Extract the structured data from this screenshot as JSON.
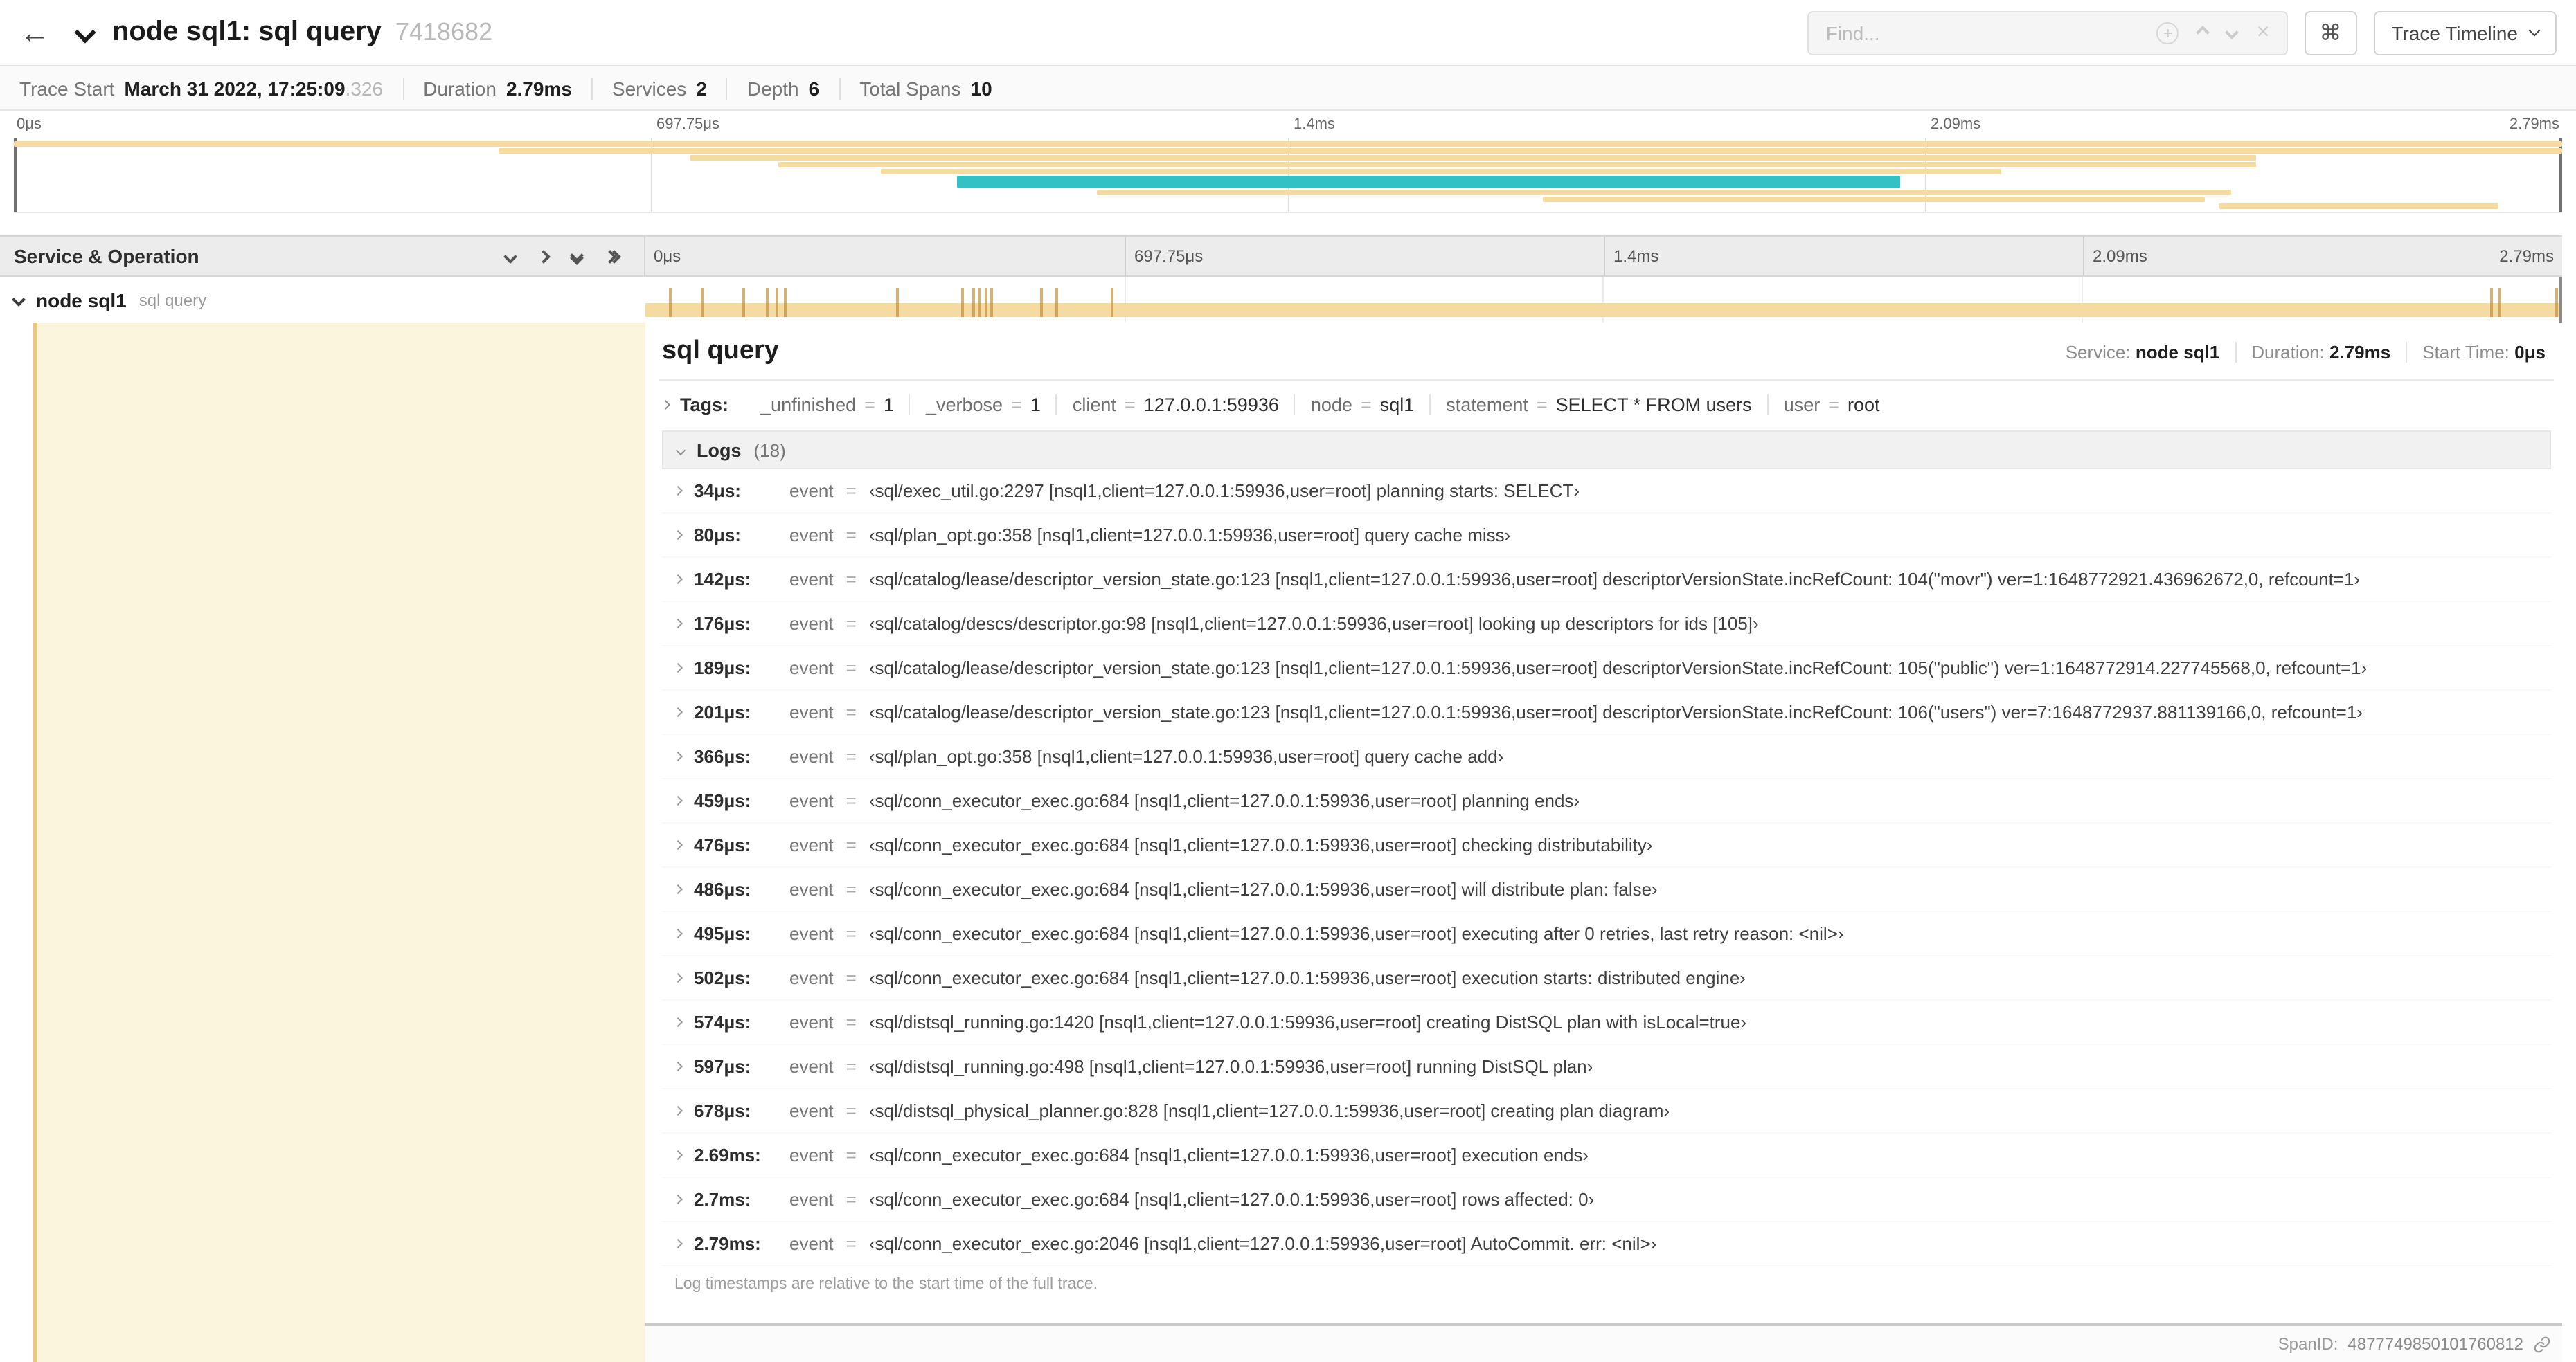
{
  "colors": {
    "tan": "#f6dba0",
    "tan_dark": "#c2903a",
    "teal": "#33c1c6",
    "cream": "#fbf5de",
    "cream_edge": "#e9c87d"
  },
  "header": {
    "title": "node sql1: sql query",
    "trace_id": "7418682",
    "find_placeholder": "Find...",
    "command_glyph": "⌘",
    "view_selector": "Trace Timeline"
  },
  "summary": {
    "items": [
      {
        "label": "Trace Start",
        "value": "March 31 2022, 17:25:09",
        "suffix": ".326"
      },
      {
        "label": "Duration",
        "value": "2.79ms",
        "suffix": ""
      },
      {
        "label": "Services",
        "value": "2",
        "suffix": ""
      },
      {
        "label": "Depth",
        "value": "6",
        "suffix": ""
      },
      {
        "label": "Total Spans",
        "value": "10",
        "suffix": ""
      }
    ]
  },
  "minimap": {
    "ticks": [
      "0μs",
      "697.75μs",
      "1.4ms",
      "2.09ms",
      "2.79ms"
    ],
    "spans": [
      {
        "l": 0,
        "w": 100,
        "r": 0,
        "c": "tan"
      },
      {
        "l": 19,
        "w": 81,
        "r": 1,
        "c": "tan"
      },
      {
        "l": 26.5,
        "w": 61.5,
        "r": 2,
        "c": "tan"
      },
      {
        "l": 30,
        "w": 58,
        "r": 3,
        "c": "tan"
      },
      {
        "l": 34,
        "w": 44,
        "r": 4,
        "c": "tan"
      },
      {
        "l": 37,
        "w": 37,
        "r": 5,
        "c": "teal",
        "h": 2
      },
      {
        "l": 42.5,
        "w": 44.5,
        "r": 7,
        "c": "tan"
      },
      {
        "l": 60,
        "w": 26,
        "r": 8,
        "c": "tan"
      },
      {
        "l": 86.5,
        "w": 11,
        "r": 9,
        "c": "tan"
      }
    ]
  },
  "timeline": {
    "left_header": "Service & Operation",
    "ticks": [
      "0μs",
      "697.75μs",
      "1.4ms",
      "2.09ms",
      "2.79ms"
    ],
    "row": {
      "service": "node sql1",
      "operation": "sql query",
      "tick_positions": [
        1.2,
        2.9,
        5.1,
        6.3,
        6.8,
        7.2,
        13.1,
        16.5,
        17.1,
        17.4,
        17.7,
        18,
        20.6,
        21.4,
        24.3,
        96.4,
        96.8,
        99.8
      ]
    }
  },
  "detail": {
    "title": "sql query",
    "service_label": "Service:",
    "service": "node sql1",
    "duration_label": "Duration:",
    "duration": "2.79ms",
    "start_label": "Start Time:",
    "start": "0μs",
    "tags_label": "Tags:",
    "eq": "=",
    "log_key": "event",
    "tags": [
      {
        "key": "_unfinished",
        "value": "1"
      },
      {
        "key": "_verbose",
        "value": "1"
      },
      {
        "key": "client",
        "value": "127.0.0.1:59936"
      },
      {
        "key": "node",
        "value": "sql1"
      },
      {
        "key": "statement",
        "value": "SELECT * FROM users"
      },
      {
        "key": "user",
        "value": "root"
      }
    ],
    "logs_label": "Logs",
    "logs_count": "(18)",
    "logs": [
      {
        "time": "34μs:",
        "value": "‹sql/exec_util.go:2297 [nsql1,client=127.0.0.1:59936,user=root] planning starts: SELECT›"
      },
      {
        "time": "80μs:",
        "value": "‹sql/plan_opt.go:358 [nsql1,client=127.0.0.1:59936,user=root] query cache miss›"
      },
      {
        "time": "142μs:",
        "value": "‹sql/catalog/lease/descriptor_version_state.go:123 [nsql1,client=127.0.0.1:59936,user=root] descriptorVersionState.incRefCount: 104(\"movr\") ver=1:1648772921.436962672,0, refcount=1›"
      },
      {
        "time": "176μs:",
        "value": "‹sql/catalog/descs/descriptor.go:98 [nsql1,client=127.0.0.1:59936,user=root] looking up descriptors for ids [105]›"
      },
      {
        "time": "189μs:",
        "value": "‹sql/catalog/lease/descriptor_version_state.go:123 [nsql1,client=127.0.0.1:59936,user=root] descriptorVersionState.incRefCount: 105(\"public\") ver=1:1648772914.227745568,0, refcount=1›"
      },
      {
        "time": "201μs:",
        "value": "‹sql/catalog/lease/descriptor_version_state.go:123 [nsql1,client=127.0.0.1:59936,user=root] descriptorVersionState.incRefCount: 106(\"users\") ver=7:1648772937.881139166,0, refcount=1›"
      },
      {
        "time": "366μs:",
        "value": "‹sql/plan_opt.go:358 [nsql1,client=127.0.0.1:59936,user=root] query cache add›"
      },
      {
        "time": "459μs:",
        "value": "‹sql/conn_executor_exec.go:684 [nsql1,client=127.0.0.1:59936,user=root] planning ends›"
      },
      {
        "time": "476μs:",
        "value": "‹sql/conn_executor_exec.go:684 [nsql1,client=127.0.0.1:59936,user=root] checking distributability›"
      },
      {
        "time": "486μs:",
        "value": "‹sql/conn_executor_exec.go:684 [nsql1,client=127.0.0.1:59936,user=root] will distribute plan: false›"
      },
      {
        "time": "495μs:",
        "value": "‹sql/conn_executor_exec.go:684 [nsql1,client=127.0.0.1:59936,user=root] executing after 0 retries, last retry reason: <nil>›"
      },
      {
        "time": "502μs:",
        "value": "‹sql/conn_executor_exec.go:684 [nsql1,client=127.0.0.1:59936,user=root] execution starts: distributed engine›"
      },
      {
        "time": "574μs:",
        "value": "‹sql/distsql_running.go:1420 [nsql1,client=127.0.0.1:59936,user=root] creating DistSQL plan with isLocal=true›"
      },
      {
        "time": "597μs:",
        "value": "‹sql/distsql_running.go:498 [nsql1,client=127.0.0.1:59936,user=root] running DistSQL plan›"
      },
      {
        "time": "678μs:",
        "value": "‹sql/distsql_physical_planner.go:828 [nsql1,client=127.0.0.1:59936,user=root] creating plan diagram›"
      },
      {
        "time": "2.69ms:",
        "value": "‹sql/conn_executor_exec.go:684 [nsql1,client=127.0.0.1:59936,user=root] execution ends›"
      },
      {
        "time": "2.7ms:",
        "value": "‹sql/conn_executor_exec.go:684 [nsql1,client=127.0.0.1:59936,user=root] rows affected: 0›"
      },
      {
        "time": "2.79ms:",
        "value": "‹sql/conn_executor_exec.go:2046 [nsql1,client=127.0.0.1:59936,user=root] AutoCommit. err: <nil>›"
      }
    ],
    "footer_note": "Log timestamps are relative to the start time of the full trace.",
    "span_id_label": "SpanID:",
    "span_id": "4877749850101760812"
  }
}
